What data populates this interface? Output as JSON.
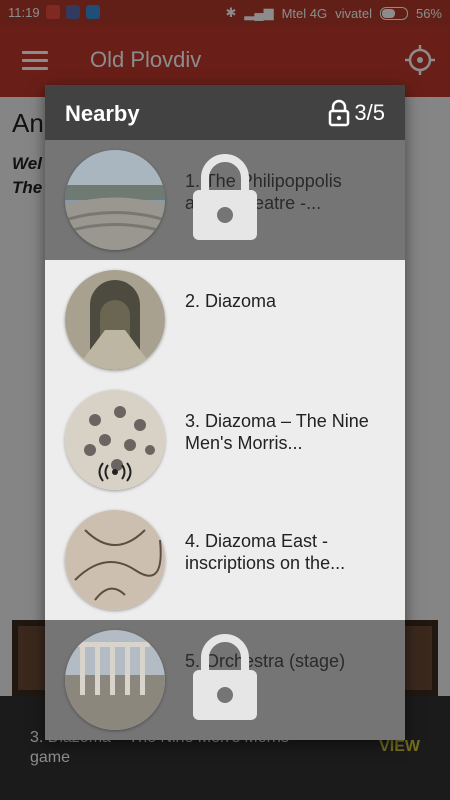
{
  "status_bar": {
    "time": "11:19",
    "carrier1": "Mtel 4G",
    "carrier2": "vivatel",
    "battery": "56%"
  },
  "app_bar": {
    "title": "Old Plovdiv"
  },
  "background_page": {
    "heading": "An",
    "intro_line1": "Wel",
    "intro_line2": "The"
  },
  "snackbar": {
    "message": "3. Diazoma – The Nine Men's Morris game",
    "action": "VIEW"
  },
  "dialog": {
    "title": "Nearby",
    "unlocked_count": "3/5",
    "items": [
      {
        "label": "1. The Philipoppolis antique teatre -...",
        "locked": true
      },
      {
        "label": "2. Diazoma",
        "locked": false
      },
      {
        "label": "3. Diazoma – The Nine Men's Morris...",
        "locked": false
      },
      {
        "label": "4. Diazoma East - inscriptions on the...",
        "locked": false
      },
      {
        "label": "5. Orchestra (stage)",
        "locked": true
      }
    ]
  },
  "colors": {
    "app_bar": "#c0392b",
    "status_bar": "#b13a2c",
    "dialog_header": "#424242",
    "snackbar_action": "#d7c93b"
  }
}
